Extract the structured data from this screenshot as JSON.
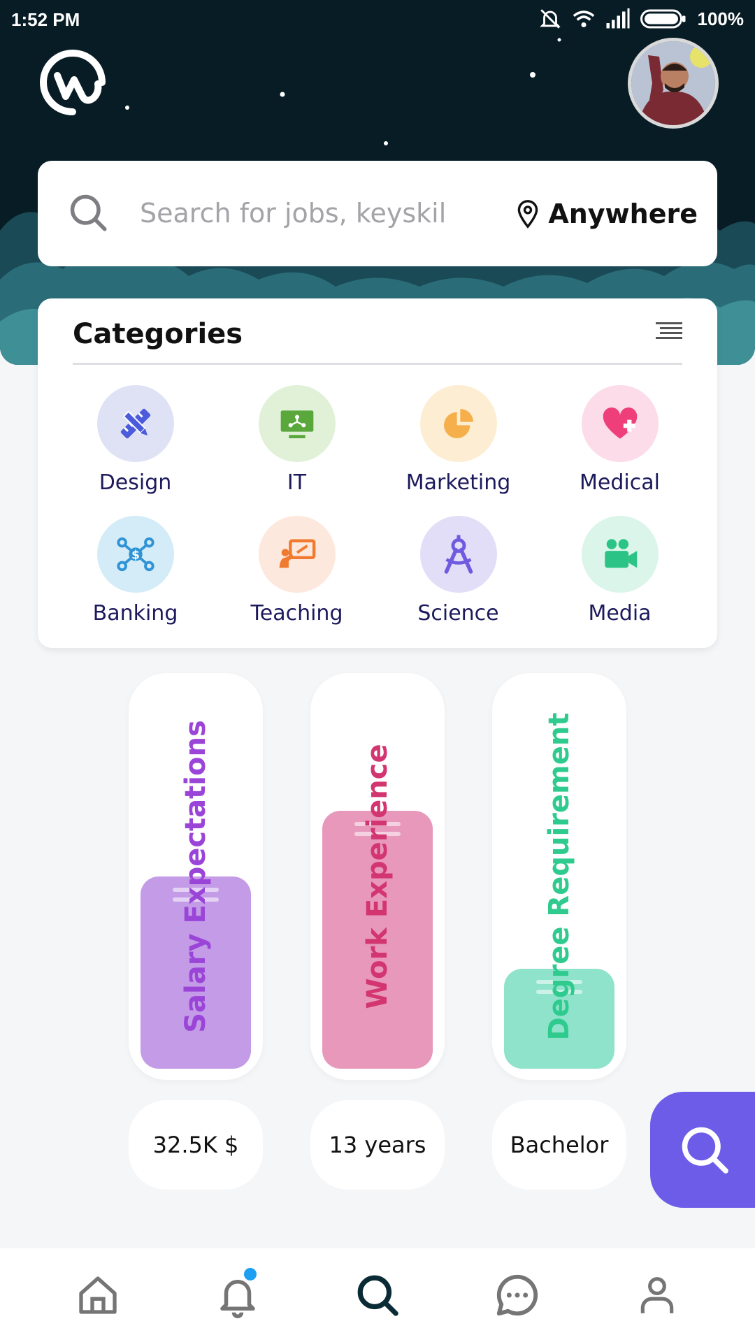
{
  "status_bar": {
    "time": "1:52 PM",
    "battery": "100%",
    "icons": [
      "mute-icon",
      "wifi-icon",
      "signal-icon",
      "battery-icon"
    ]
  },
  "header": {
    "logo": "workplace-logo",
    "avatar": "user-avatar"
  },
  "search": {
    "placeholder": "Search for jobs, keyskills",
    "location_label": "Anywhere",
    "icon": "search-icon",
    "location_icon": "location-pin-icon"
  },
  "categories": {
    "title": "Categories",
    "menu_icon": "menu-lines-icon",
    "items": [
      {
        "label": "Design",
        "icon": "ruler-pencil-icon",
        "bg": "#dfe2f5",
        "color": "#4a5bdc"
      },
      {
        "label": "IT",
        "icon": "monitor-icon",
        "bg": "#e1f1d8",
        "color": "#5aa73b"
      },
      {
        "label": "Marketing",
        "icon": "pie-chart-icon",
        "bg": "#fdeed3",
        "color": "#f5b04b"
      },
      {
        "label": "Medical",
        "icon": "heart-cross-icon",
        "bg": "#fcdce9",
        "color": "#ee3f7b"
      },
      {
        "label": "Banking",
        "icon": "money-network-icon",
        "bg": "#d4ecf7",
        "color": "#2f93d6"
      },
      {
        "label": "Teaching",
        "icon": "teacher-board-icon",
        "bg": "#fde8dd",
        "color": "#f07a2e"
      },
      {
        "label": "Science",
        "icon": "compass-icon",
        "bg": "#e3def8",
        "color": "#6f5be0"
      },
      {
        "label": "Media",
        "icon": "video-camera-icon",
        "bg": "#dcf5ea",
        "color": "#2cc486"
      }
    ]
  },
  "filters": [
    {
      "label": "Salary Expectations",
      "value": "32.5K $",
      "level": 0.5,
      "fill": "#c39be6",
      "text_color": "#9b45d8"
    },
    {
      "label": "Work Experience",
      "value": "13 years",
      "level": 0.67,
      "fill": "#e798bb",
      "text_color": "#d2356f"
    },
    {
      "label": "Degree Requirement",
      "value": "Bachelor",
      "level": 0.26,
      "fill": "#8fe3cb",
      "text_color": "#2fcb8e"
    }
  ],
  "fab": {
    "icon": "search-icon",
    "color": "#6c5ce7"
  },
  "bottom_nav": {
    "items": [
      {
        "name": "home",
        "icon": "home-icon"
      },
      {
        "name": "notifications",
        "icon": "bell-icon",
        "badge": true
      },
      {
        "name": "search",
        "icon": "search-icon",
        "active": true
      },
      {
        "name": "messages",
        "icon": "chat-icon"
      },
      {
        "name": "profile",
        "icon": "user-icon"
      }
    ]
  }
}
